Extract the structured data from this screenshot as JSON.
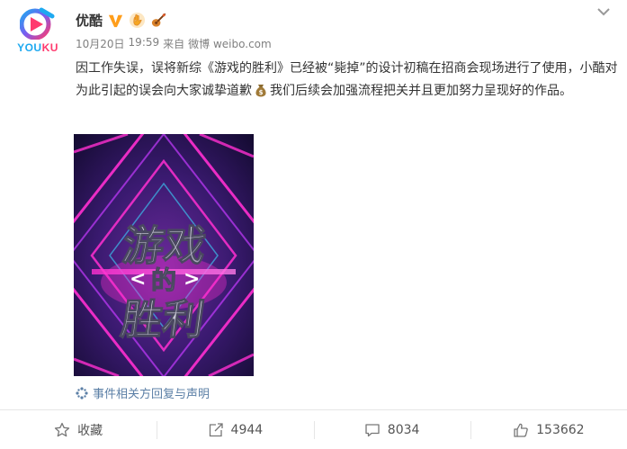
{
  "account": {
    "logo_text_you": "YOU",
    "logo_text_ku": "KU",
    "username": "优酷",
    "verified_icon": "verified-v-icon",
    "badges": [
      "hand-badge-icon",
      "guitar-badge-icon"
    ]
  },
  "post": {
    "date": "10月20日",
    "time": "19:59",
    "source_prefix": "来自",
    "source": "微博 weibo.com",
    "text_part1": "因工作失误，误将新综《游戏的胜利》已经被“毙掉”的设计初稿在招商会现场进行了使用，小酷对为此引起的误会向大家诚挚道歉",
    "emoji": "money-bag-emoji",
    "text_part2": "我们后续会加强流程把关并且更加努力呈现好的作品。",
    "poster": {
      "title_line1": "游戏",
      "title_line2": "的",
      "title_line3": "胜利"
    },
    "statement_link": "事件相关方回复与声明"
  },
  "actions": {
    "favorite_label": "收藏",
    "repost_count": "4944",
    "comment_count": "8034",
    "like_count": "153662"
  },
  "colors": {
    "link": "#5b7fa6",
    "verified": "#ff9e1b",
    "brand_blue": "#1ea9f0",
    "brand_pink": "#ff3a6e"
  }
}
